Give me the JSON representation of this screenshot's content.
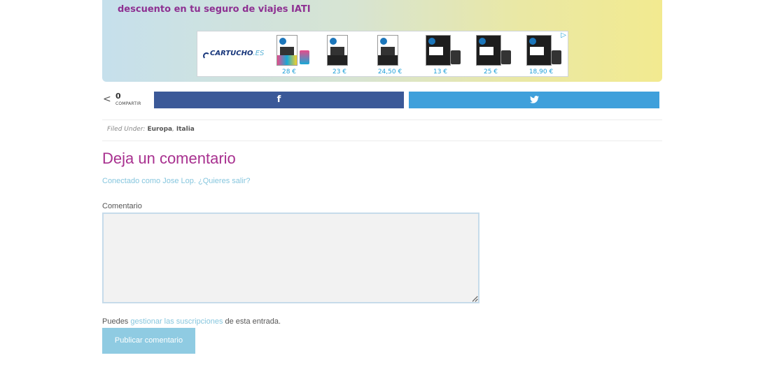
{
  "banner": {
    "title": "descuento en tu seguro de viajes IATI",
    "ad": {
      "logo_main": "CARTUCHO",
      "logo_suffix": ".ES",
      "choice_icon": "adchoices-triangle-icon",
      "items": [
        {
          "price": "28 €"
        },
        {
          "price": "23 €"
        },
        {
          "price": "24,50 €"
        },
        {
          "price": "13 €"
        },
        {
          "price": "25 €"
        },
        {
          "price": "18,90 €"
        }
      ]
    }
  },
  "share": {
    "icon": "share-icon",
    "count": "0",
    "label": "COMPARTIR",
    "facebook_glyph": "f",
    "twitter_glyph": "🐦",
    "colors": {
      "facebook": "#3b5998",
      "twitter": "#3fa0db"
    }
  },
  "filed": {
    "prefix": "Filed Under:",
    "cat1": "Europa",
    "sep": ",",
    "cat2": "Italia"
  },
  "comments": {
    "heading": "Deja un comentario",
    "logged_in": "Conectado como Jose Lop. ¿Quieres salir?",
    "field_label": "Comentario",
    "subs_prefix": "Puedes",
    "subs_link": "gestionar las suscripciones",
    "subs_suffix": "de esta entrada.",
    "submit_label": "Publicar comentario"
  },
  "colors": {
    "heading": "#a8308f",
    "link": "#86c6de",
    "button": "#8fcbe2"
  }
}
